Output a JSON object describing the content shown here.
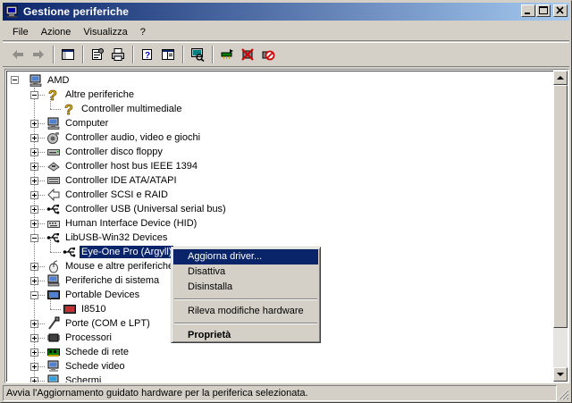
{
  "window": {
    "title": "Gestione periferiche",
    "controls": {
      "minimize": "_",
      "maximize": "□",
      "close": "×"
    }
  },
  "menubar": {
    "items": [
      {
        "label": "File"
      },
      {
        "label": "Azione"
      },
      {
        "label": "Visualizza"
      },
      {
        "label": "?"
      }
    ]
  },
  "toolbar": {
    "tools": [
      {
        "icon": "back-arrow-icon"
      },
      {
        "icon": "forward-arrow-icon"
      },
      {
        "icon": "show-hide-console-tree-icon"
      },
      {
        "icon": "properties-icon"
      },
      {
        "icon": "print-icon"
      },
      {
        "icon": "help-icon"
      },
      {
        "icon": "view-pane-icon"
      },
      {
        "icon": "scan-hardware-icon"
      },
      {
        "icon": "update-driver-icon"
      },
      {
        "icon": "uninstall-icon"
      },
      {
        "icon": "disable-icon"
      }
    ]
  },
  "tree": {
    "root": "AMD",
    "items": [
      {
        "label": "Altre periferiche",
        "icon": "unknown-device-icon"
      },
      {
        "label": "Controller multimediale",
        "icon": "unknown-device-icon"
      },
      {
        "label": "Computer",
        "icon": "computer-icon"
      },
      {
        "label": "Controller audio, video e giochi",
        "icon": "audio-icon"
      },
      {
        "label": "Controller disco floppy",
        "icon": "floppy-controller-icon"
      },
      {
        "label": "Controller host bus IEEE 1394",
        "icon": "ieee1394-icon"
      },
      {
        "label": "Controller IDE ATA/ATAPI",
        "icon": "ide-icon"
      },
      {
        "label": "Controller SCSI e RAID",
        "icon": "scsi-icon"
      },
      {
        "label": "Controller USB (Universal serial bus)",
        "icon": "usb-icon"
      },
      {
        "label": "Human Interface Device (HID)",
        "icon": "hid-icon"
      },
      {
        "label": "LibUSB-Win32 Devices",
        "icon": "usb-icon"
      },
      {
        "label": "Eye-One Pro (Argyll)",
        "icon": "usb-icon"
      },
      {
        "label": "Mouse e altre periferiche d",
        "icon": "mouse-icon"
      },
      {
        "label": "Periferiche di sistema",
        "icon": "system-device-icon"
      },
      {
        "label": "Portable Devices",
        "icon": "portable-device-icon"
      },
      {
        "label": "I8510",
        "icon": "phone-icon"
      },
      {
        "label": "Porte (COM e LPT)",
        "icon": "port-icon"
      },
      {
        "label": "Processori",
        "icon": "processor-icon"
      },
      {
        "label": "Schede di rete",
        "icon": "network-card-icon"
      },
      {
        "label": "Schede video",
        "icon": "display-adapter-icon"
      },
      {
        "label": "Schermi",
        "icon": "monitor-icon"
      }
    ]
  },
  "context_menu": {
    "items": [
      {
        "label": "Aggiorna driver..."
      },
      {
        "label": "Disattiva"
      },
      {
        "label": "Disinstalla"
      },
      {
        "label": "Rileva modifiche hardware"
      },
      {
        "label": "Proprietà"
      }
    ]
  },
  "statusbar": {
    "text": "Avvia l'Aggiornamento guidato hardware per la periferica selezionata."
  },
  "colors": {
    "titlebar_start": "#0a246a",
    "titlebar_end": "#a6caf0",
    "selection": "#0a246a",
    "face": "#d4d0c8"
  }
}
